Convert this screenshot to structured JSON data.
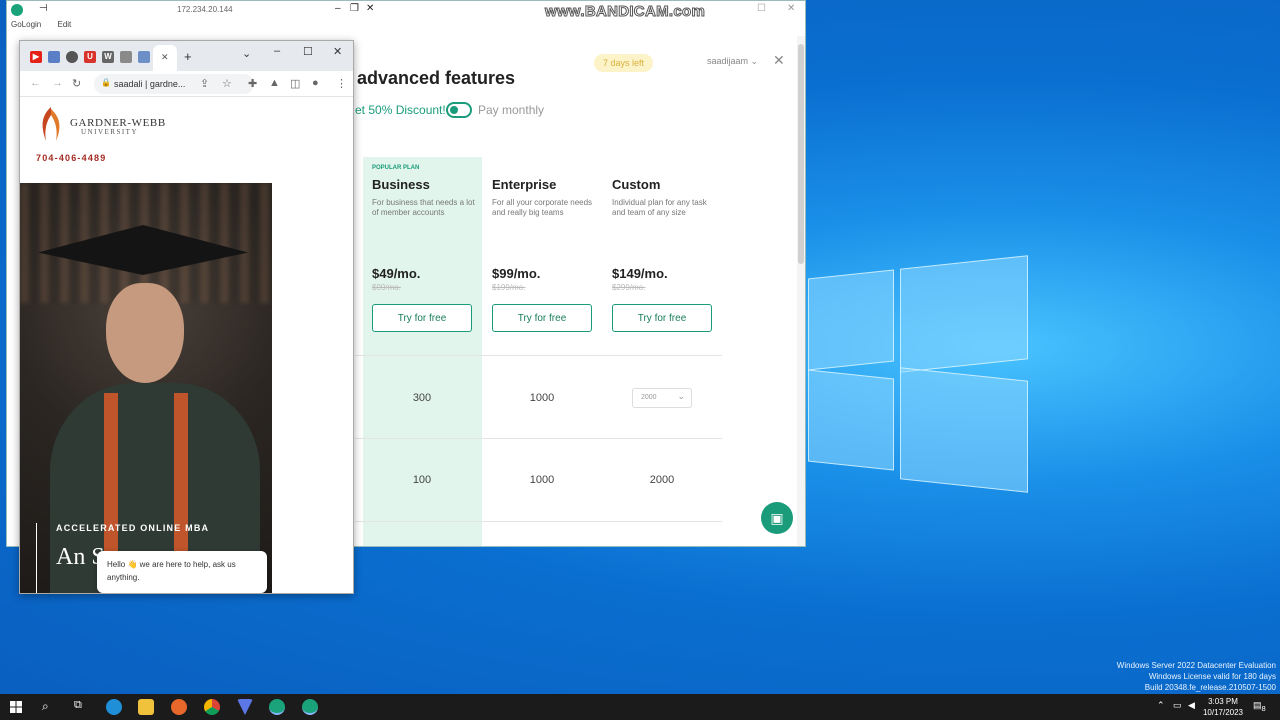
{
  "host_window": {
    "ip": "172.234.20.144",
    "menu": [
      "GoLogin",
      "Edit"
    ]
  },
  "overlay": {
    "bandicam": "www.BANDICAM.com"
  },
  "pricing": {
    "heading": "advanced features",
    "days_left": "7 days left",
    "user": "saadijaam",
    "discount": "et 50% Discount!",
    "pay_monthly": "Pay monthly",
    "plans": [
      {
        "tag": "POPULAR PLAN",
        "name": "Business",
        "desc": "For business that needs a lot of member accounts",
        "price": "$49/mo.",
        "old_price": "$99/mo.",
        "cta": "Try for free",
        "row1": "300",
        "row2": "100"
      },
      {
        "tag": "",
        "name": "Enterprise",
        "desc": "For all your corporate needs and really big teams",
        "price": "$99/mo.",
        "old_price": "$199/mo.",
        "cta": "Try for free",
        "row1": "1000",
        "row2": "1000"
      },
      {
        "tag": "",
        "name": "Custom",
        "desc": "Individual plan for any task and team of any size",
        "price": "$149/mo.",
        "old_price": "$299/mo.",
        "cta": "Try for free",
        "row1": "2000",
        "row2": "2000"
      }
    ]
  },
  "chrome": {
    "omnibox_text": "saadali | gardne...",
    "site": {
      "brand": "GARDNER-WEBB",
      "brand_sub": "UNIVERSITY",
      "phone": "704-406-4489",
      "hero_tag": "ACCELERATED ONLINE MBA",
      "hero_big": "An Spe",
      "chat_popup": "Hello 👋 we are here to help, ask us anything."
    }
  },
  "watermark": {
    "line1": "Windows Server 2022 Datacenter Evaluation",
    "line2": "Windows License valid for 180 days",
    "line3": "Build 20348.fe_release.210507-1500"
  },
  "taskbar": {
    "time": "3:03 PM",
    "date": "10/17/2023",
    "notification_count": "8"
  },
  "colors": {
    "accent": "#1a9c7a",
    "highlight": "#e2f5ec",
    "gw_red": "#a32b22",
    "taskbar": "#1b1b1b"
  }
}
